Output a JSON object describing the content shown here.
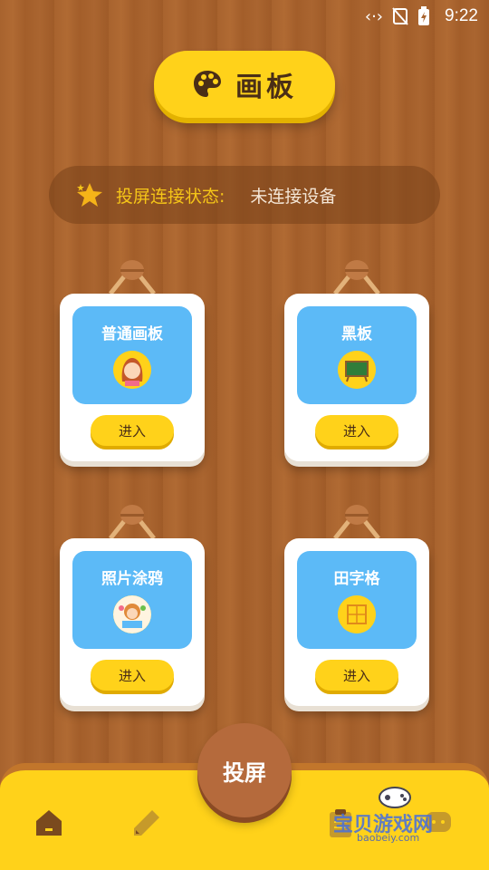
{
  "status_bar": {
    "time": "9:22"
  },
  "header": {
    "title": "画板"
  },
  "connection": {
    "label": "投屏连接状态:",
    "value": "未连接设备"
  },
  "cards": [
    {
      "title": "普通画板",
      "button": "进入",
      "icon": "girl-avatar-icon"
    },
    {
      "title": "黑板",
      "button": "进入",
      "icon": "chalkboard-icon"
    },
    {
      "title": "照片涂鸦",
      "button": "进入",
      "icon": "photo-doodle-icon"
    },
    {
      "title": "田字格",
      "button": "进入",
      "icon": "grid-icon"
    }
  ],
  "bottom_nav": {
    "cast_label": "投屏",
    "items": [
      "home-icon",
      "pencil-icon",
      "clipboard-icon",
      "chat-icon"
    ]
  },
  "watermark": {
    "text": "宝贝游戏网",
    "url": "baobeiy.com"
  },
  "colors": {
    "accent": "#ffd21a",
    "card_inner": "#5cbaf7",
    "cast_button": "#b56a3c"
  }
}
